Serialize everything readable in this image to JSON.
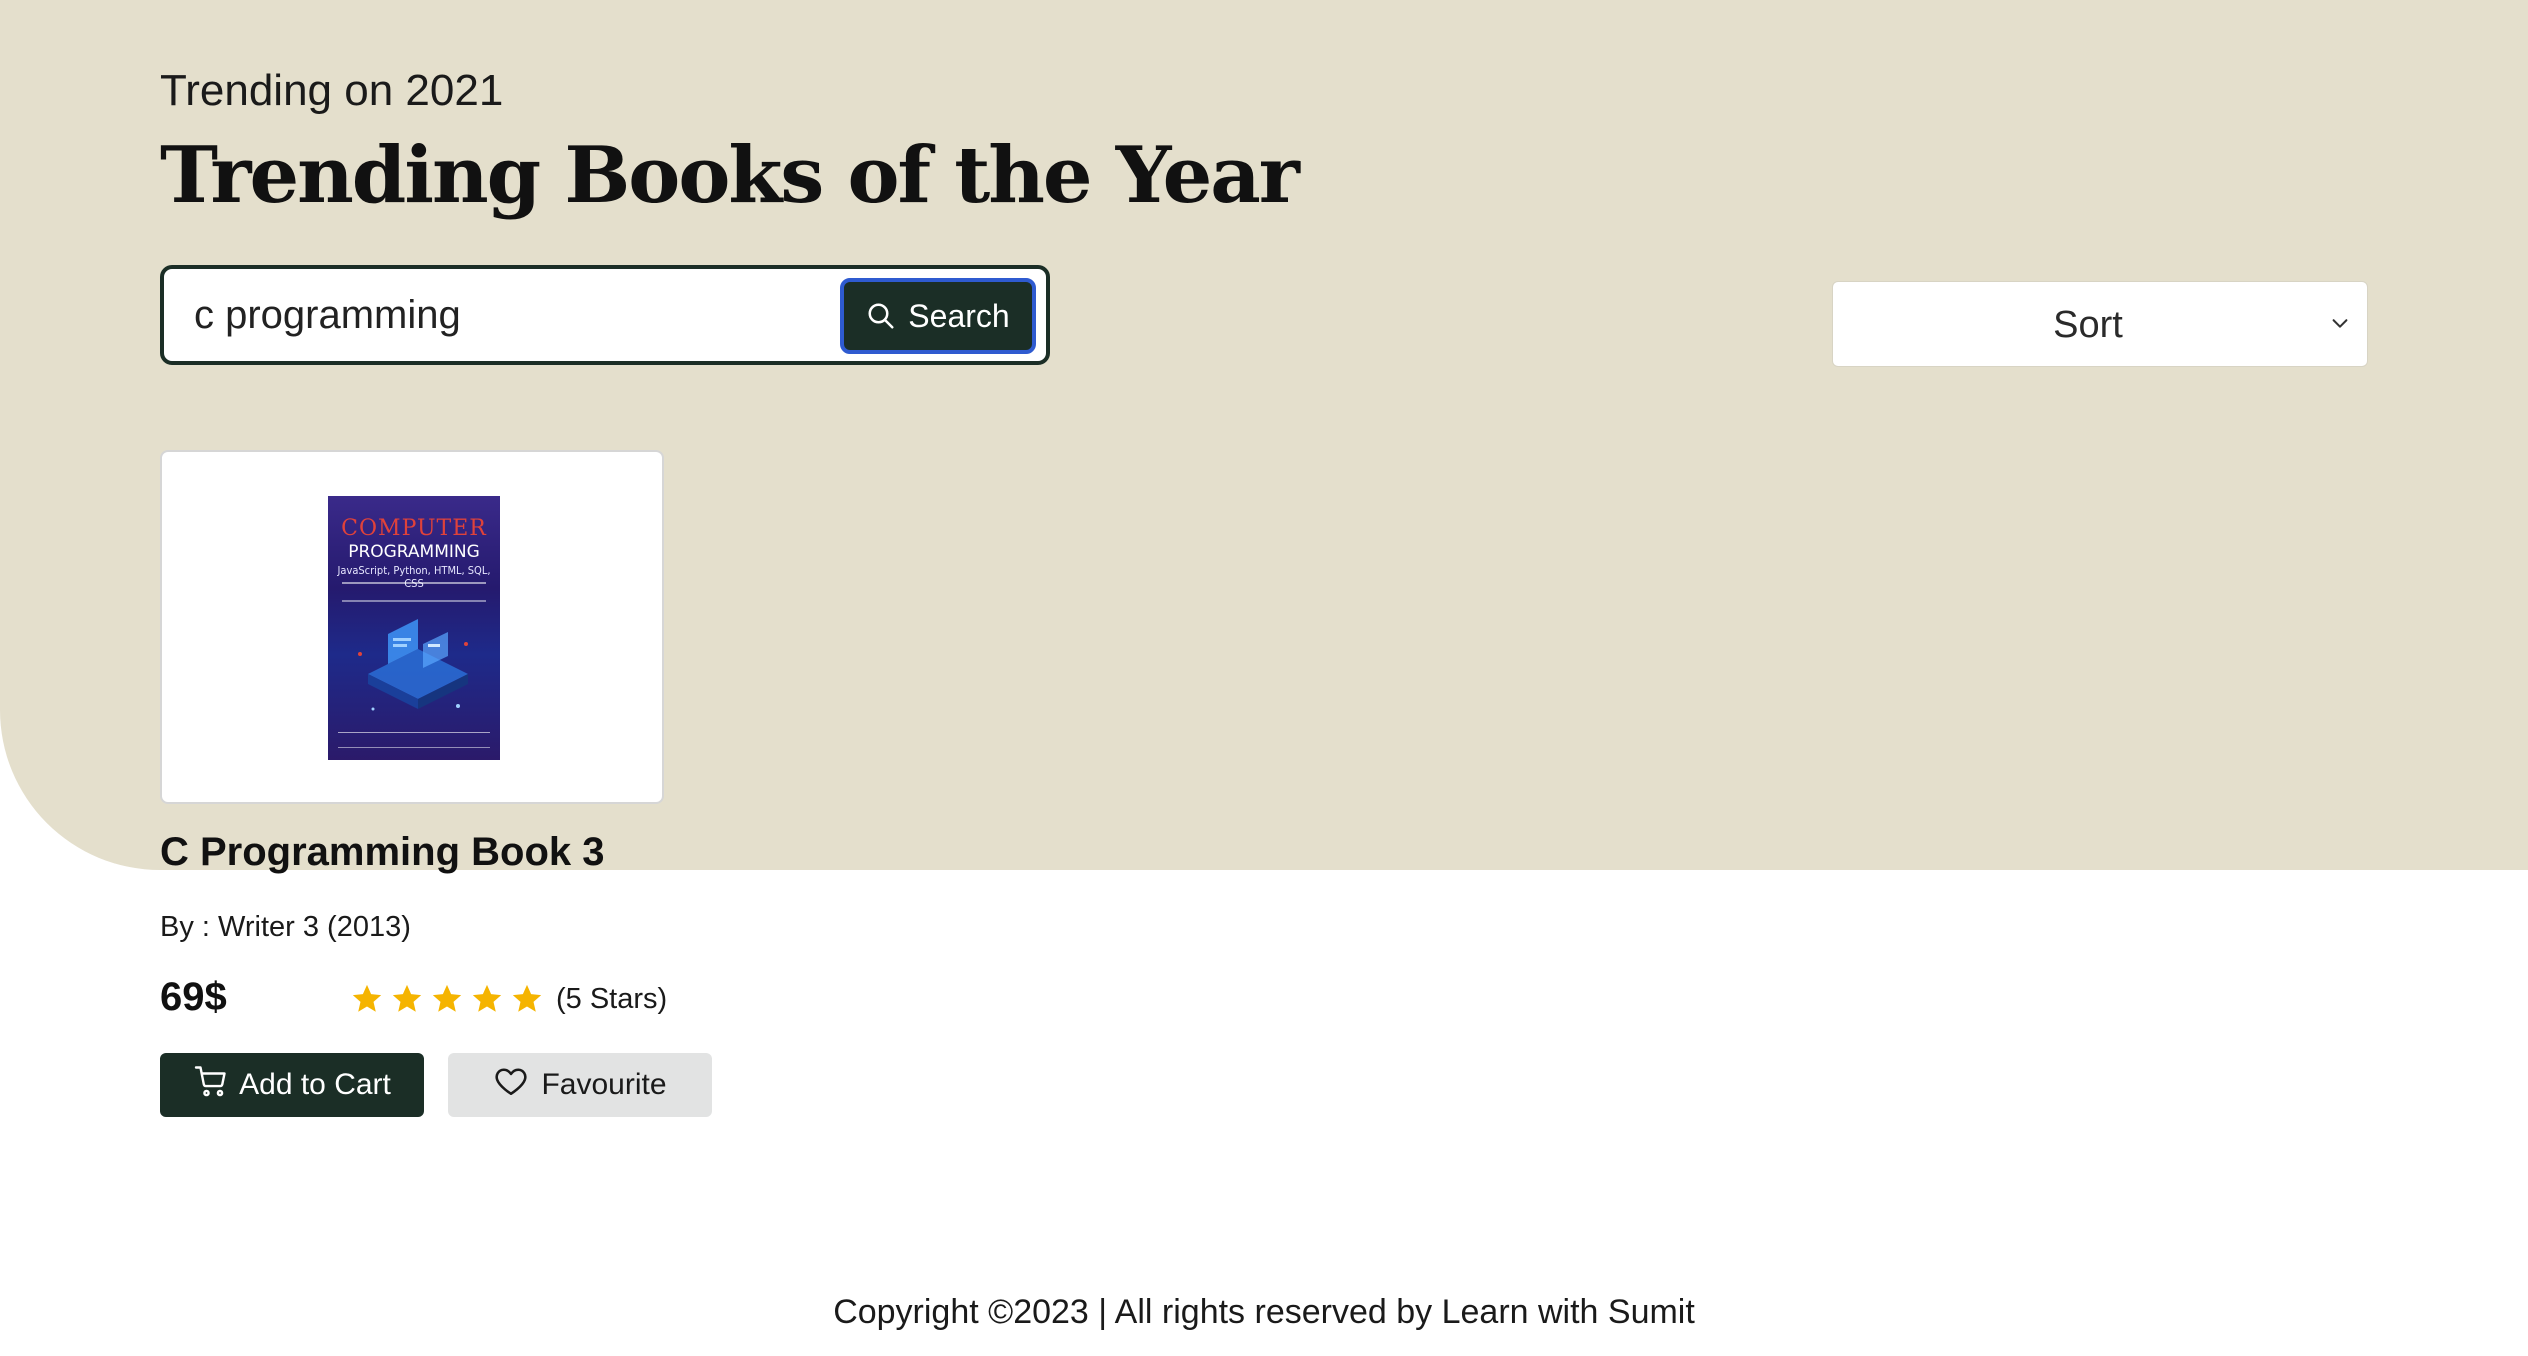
{
  "header": {
    "subtitle": "Trending on 2021",
    "title": "Trending Books of the Year"
  },
  "search": {
    "value": "c programming",
    "placeholder": "",
    "button_label": "Search",
    "button_icon": "search-icon"
  },
  "sort": {
    "label": "Sort",
    "icon": "chevron-down-icon"
  },
  "books": [
    {
      "cover": {
        "line1": "COMPUTER",
        "line2": "PROGRAMMING",
        "line3": "JavaScript, Python, HTML, SQL, CSS"
      },
      "title": "C Programming Book 3",
      "author": "By : Writer 3 (2013)",
      "price": "69$",
      "rating": 5,
      "rating_text": "(5 Stars)",
      "add_to_cart_label": "Add to Cart",
      "favourite_label": "Favourite"
    }
  ],
  "footer": {
    "copyright": "Copyright ©2023 | All rights reserved by Learn with Sumit"
  },
  "colors": {
    "hero_background": "#e4dfcc",
    "primary_dark": "#1b2e26",
    "focus_ring": "#2f5bd0",
    "star": "#f5b400",
    "secondary_button": "#e2e3e3"
  }
}
